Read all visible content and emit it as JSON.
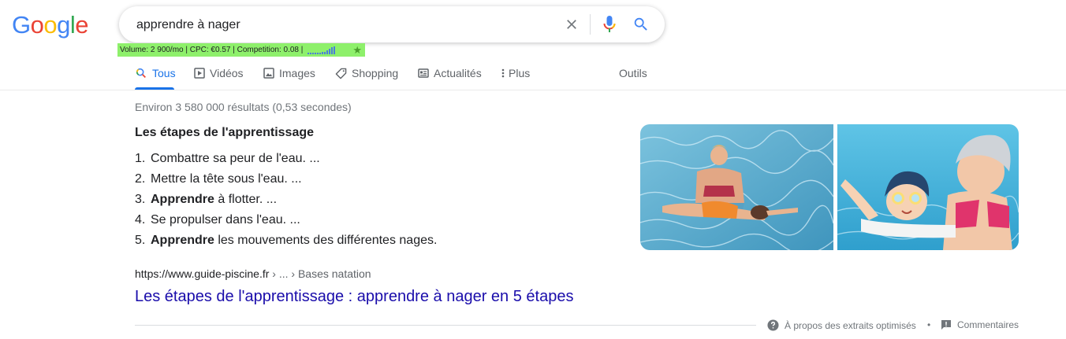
{
  "logo": {
    "letters": [
      "G",
      "o",
      "o",
      "g",
      "l",
      "e"
    ],
    "colors": [
      "#4285F4",
      "#EA4335",
      "#FBBC05",
      "#4285F4",
      "#34A853",
      "#EA4335"
    ]
  },
  "search": {
    "value": "apprendre à nager",
    "clear_icon": "close-icon",
    "voice_icon": "mic-icon",
    "submit_icon": "search-icon"
  },
  "keyword_bar": {
    "text": "Volume: 2 900/mo | CPC: €0.57 | Competition: 0.08 |",
    "accent": "#8ef06b",
    "star": "★"
  },
  "tabs": [
    {
      "label": "Tous",
      "icon": "search-icon",
      "active": true
    },
    {
      "label": "Vidéos",
      "icon": "play-icon"
    },
    {
      "label": "Images",
      "icon": "image-icon"
    },
    {
      "label": "Shopping",
      "icon": "tag-icon"
    },
    {
      "label": "Actualités",
      "icon": "news-icon"
    },
    {
      "label": "Plus",
      "icon": "more-vert-icon"
    }
  ],
  "tools_label": "Outils",
  "stats": "Environ 3 580 000 résultats (0,53 secondes)",
  "snippet": {
    "title": "Les étapes de l'apprentissage",
    "steps": [
      {
        "num": "1.",
        "bold": "",
        "text": "Combattre sa peur de l'eau. ..."
      },
      {
        "num": "2.",
        "bold": "",
        "text": "Mettre la tête sous l'eau. ..."
      },
      {
        "num": "3.",
        "bold": "Apprendre",
        "text": " à flotter. ..."
      },
      {
        "num": "4.",
        "bold": "",
        "text": "Se propulser dans l'eau. ..."
      },
      {
        "num": "5.",
        "bold": "Apprendre",
        "text": " les mouvements des différentes nages."
      }
    ]
  },
  "result": {
    "url": "https://www.guide-piscine.fr",
    "crumbs": " › ... › Bases natation",
    "title": "Les étapes de l'apprentissage : apprendre à nager en 5 étapes"
  },
  "footer": {
    "about": "À propos des extraits optimisés",
    "separator": "•",
    "feedback": "Commentaires"
  }
}
